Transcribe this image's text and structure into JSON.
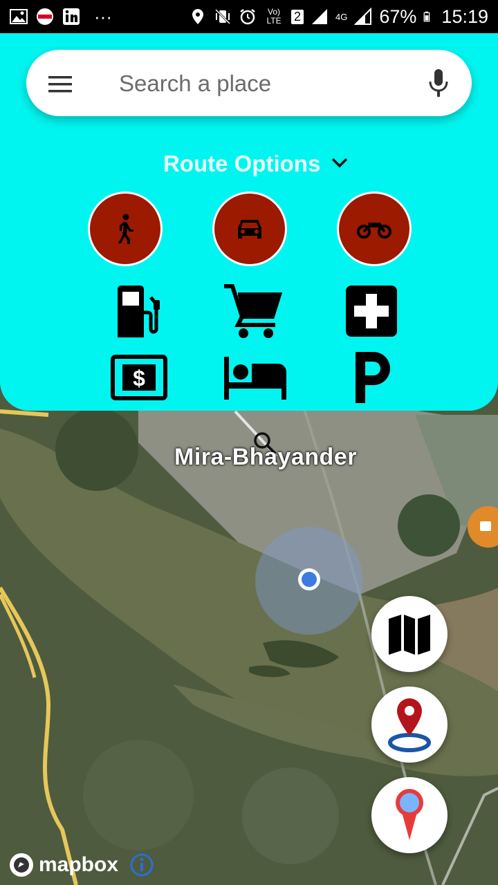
{
  "status_bar": {
    "signal_labels": [
      "Vo) LTE",
      "2",
      "4G"
    ],
    "battery": "67%",
    "time": "15:19",
    "dots": "···"
  },
  "search": {
    "placeholder": "Search a place"
  },
  "route_options": {
    "title": "Route Options",
    "modes": [
      "walk",
      "car",
      "motorcycle"
    ]
  },
  "poi_categories": [
    "fuel",
    "shopping-cart",
    "hospital",
    "atm",
    "hotel",
    "parking"
  ],
  "map": {
    "place_label": "Mira-Bhayander",
    "attribution": "mapbox"
  },
  "colors": {
    "panel": "#00f5f0",
    "mode_button": "#9b1a00",
    "location_dot": "#3d7be0"
  }
}
